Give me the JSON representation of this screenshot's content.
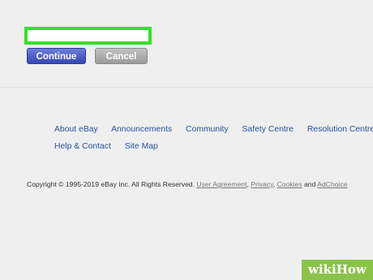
{
  "form": {
    "input_value": "",
    "continue_label": "Continue",
    "cancel_label": "Cancel"
  },
  "footer": {
    "row1": [
      "About eBay",
      "Announcements",
      "Community",
      "Safety Centre",
      "Resolution Centre"
    ],
    "row2": [
      "Help & Contact",
      "Site Map"
    ]
  },
  "copyright": {
    "text": "Copyright © 1995-2019 eBay Inc. All Rights Reserved.",
    "user_agreement": "User Agreement",
    "sep1": ",",
    "privacy": "Privacy",
    "sep2": ",",
    "cookies": "Cookies",
    "and": "and",
    "adchoice": "AdChoice"
  },
  "watermark": {
    "text": "wikiHow"
  },
  "colors": {
    "highlight_border": "#35e02a",
    "continue_button": "#3447b4",
    "cancel_button": "#9a9a9a",
    "link": "#2453a0",
    "watermark_bg": "#8bc34a"
  }
}
